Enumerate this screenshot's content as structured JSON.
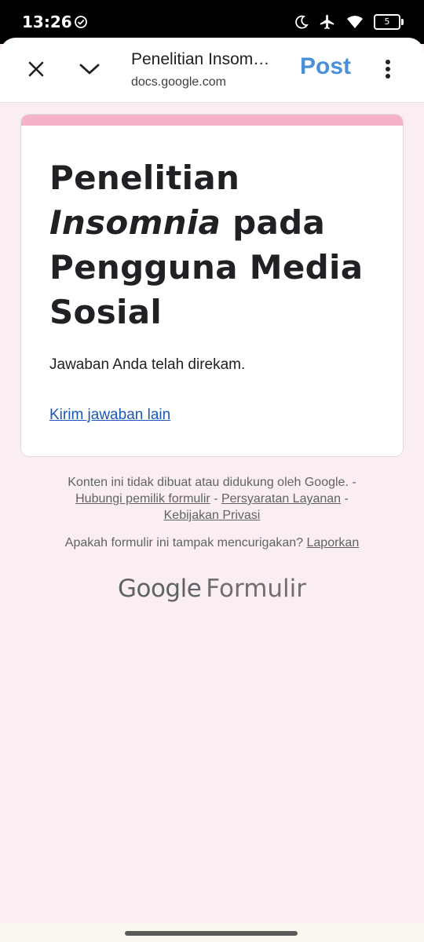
{
  "status_bar": {
    "time": "13:26",
    "battery_level": "5",
    "icons": [
      "check-circle-icon",
      "moon-icon",
      "airplane-icon",
      "wifi-icon",
      "battery-icon"
    ]
  },
  "browser": {
    "title": "Penelitian Insomnia pada Pengguna Media Sosial",
    "url": "docs.google.com",
    "action_label": "Post",
    "icons": [
      "close-icon",
      "chevron-down-icon",
      "more-vert-icon"
    ]
  },
  "form": {
    "title_part1": "Penelitian ",
    "title_italic": "Insomnia",
    "title_part2": " pada Pengguna Media Sosial",
    "confirmation": "Jawaban Anda telah direkam.",
    "another_response_link": "Kirim jawaban lain",
    "accent_color": "#f4b3c8"
  },
  "footer": {
    "disclaimer": "Konten ini tidak dibuat atau didukung oleh Google.",
    "separator": " - ",
    "contact_owner": "Hubungi pemilik formulir",
    "terms": "Persyaratan Layanan",
    "privacy": "Kebijakan Privasi",
    "suspicious_question": "Apakah formulir ini tampak mencurigakan?",
    "report_link": "Laporkan"
  },
  "brand": {
    "google": "Google",
    "product": "Formulir"
  }
}
